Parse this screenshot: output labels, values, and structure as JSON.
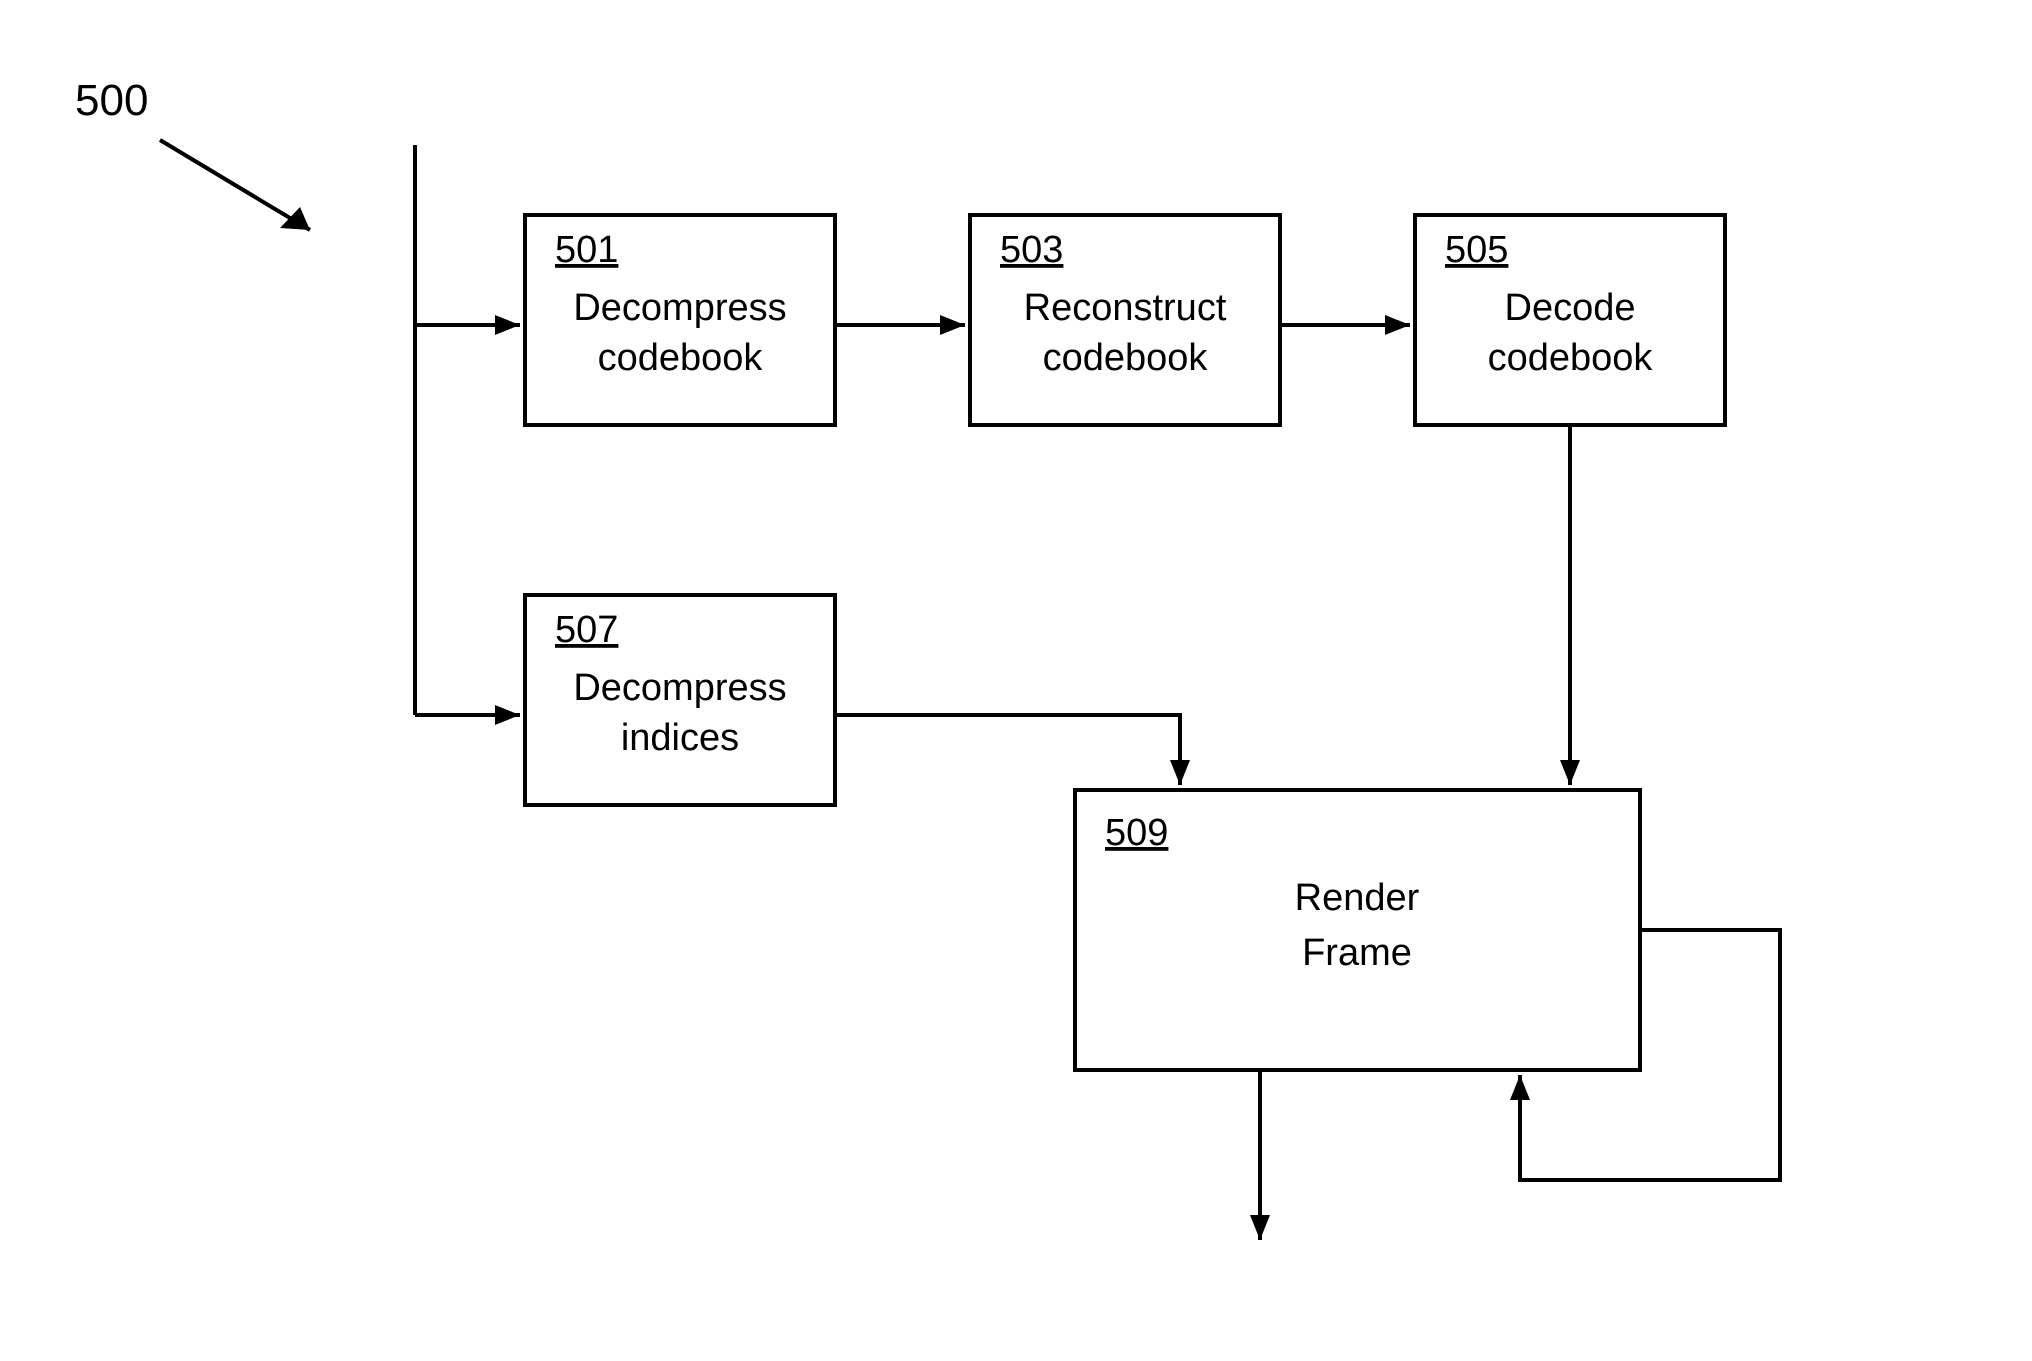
{
  "diagram": {
    "ref": "500",
    "blocks": {
      "b501": {
        "num": "501",
        "line1": "Decompress",
        "line2": "codebook"
      },
      "b503": {
        "num": "503",
        "line1": "Reconstruct",
        "line2": "codebook"
      },
      "b505": {
        "num": "505",
        "line1": "Decode",
        "line2": "codebook"
      },
      "b507": {
        "num": "507",
        "line1": "Decompress",
        "line2": "indices"
      },
      "b509": {
        "num": "509",
        "line1": "Render",
        "line2": "Frame"
      }
    }
  }
}
